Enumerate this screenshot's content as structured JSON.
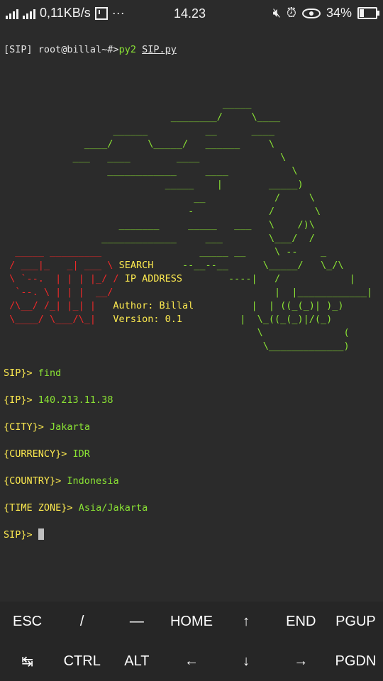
{
  "status": {
    "net_speed": "0,11KB/s",
    "more": "···",
    "time": "14.23",
    "battery": "34%",
    "battery_level": 0.34
  },
  "terminal": {
    "prompt": "[SIP] root@billal~#>",
    "cmd_word": "py2",
    "cmd_file": "SIP.py",
    "art": {
      "l1": "                                      _____",
      "l2": "                             ________/     \\____",
      "l3": "                   ______          __      ____",
      "l4": "              ____/      \\_____/   ______     \\",
      "l5": "            ___   ____        ____              \\",
      "l6": "                  ____________     ____           \\",
      "l7": "                            _____    |        _____)",
      "l8": "                                 __            /     \\",
      "l9": "                                -             /       \\",
      "l10": "                    _______     _____   ___   \\    /)\\",
      "l11": "                 _____________     ___        \\___/  /",
      "l12a": "  _____ _________",
      "l12b": "                 _____ __     \\ --    _          /\\",
      "l13a": " / ___|_   _| ___ \\",
      "l13b": " SEARCH",
      "l13c": "     --__--__      \\_____/   \\_/\\",
      "l14a": " \\ `--.  | | | |_/ /",
      "l14b": " IP ADDRESS",
      "l14c": "        ----|   /            |",
      "l15a": "  `--. \\ | | |  __/",
      "l15b": "                            |  |____________|",
      "l16a": " /\\__/ /_| |_| |",
      "l16b": "   Author: Billal",
      "l16c": "          |  | ((_(_)| )_)",
      "l17a": " \\____/ \\___/\\_|",
      "l17b": "   Version: 0.1",
      "l17c": "          |  \\_((_(_)|/(_)",
      "l18": "                                            \\              (",
      "l19": "                                             \\_____________)"
    },
    "lines": [
      {
        "label": "SIP}>",
        "value": "find"
      },
      {
        "label": "{IP}>",
        "value": "140.213.11.38"
      },
      {
        "label": "{CITY}>",
        "value": "Jakarta"
      },
      {
        "label": "{CURRENCY}>",
        "value": "IDR"
      },
      {
        "label": "{COUNTRY}>",
        "value": "Indonesia"
      },
      {
        "label": "{TIME ZONE}>",
        "value": "Asia/Jakarta"
      }
    ],
    "final_prompt": "SIP}>"
  },
  "keys": {
    "row1": [
      "ESC",
      "/",
      "—",
      "HOME",
      "↑",
      "END",
      "PGUP"
    ],
    "row2": [
      "↹",
      "CTRL",
      "ALT",
      "←",
      "↓",
      "→",
      "PGDN"
    ]
  }
}
